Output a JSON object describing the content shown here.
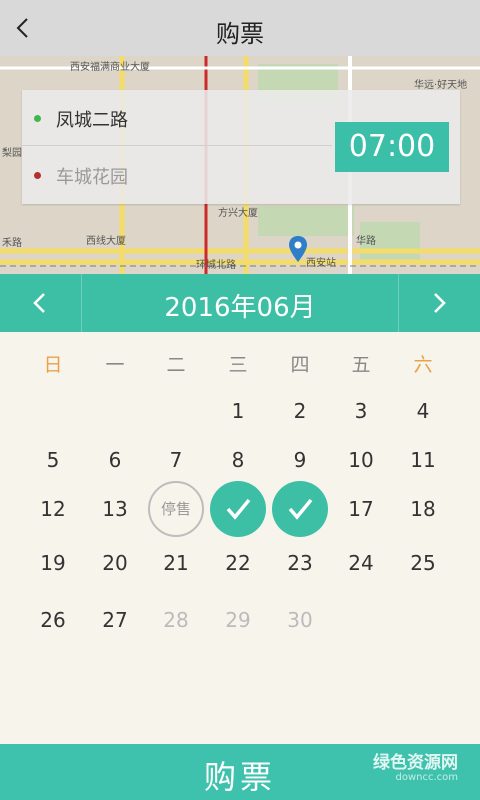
{
  "header": {
    "title": "购票",
    "back_icon": "chevron-left-icon"
  },
  "map": {
    "pois": [
      "西安福满商业大厦",
      "华远·好天地",
      "西线大厦",
      "方兴大厦",
      "西安站",
      "环城北路",
      "梨园",
      "禾路",
      "华路"
    ]
  },
  "route": {
    "from": "凤城二路",
    "to": "车城花园",
    "time": "07:00",
    "from_color": "#3fb64b",
    "to_color": "#b3302f"
  },
  "calendar": {
    "month_label": "2016年06月",
    "weekdays": [
      "日",
      "一",
      "二",
      "三",
      "四",
      "五",
      "六"
    ],
    "days": [
      [
        "",
        "",
        "",
        "1",
        "2",
        "3",
        "4"
      ],
      [
        "5",
        "6",
        "7",
        "8",
        "9",
        "10",
        "11"
      ],
      [
        "12",
        "13",
        "停售",
        "✓",
        "✓",
        "17",
        "18"
      ],
      [
        "19",
        "20",
        "21",
        "22",
        "23",
        "24",
        "25"
      ],
      [
        "26",
        "27",
        "28",
        "29",
        "30",
        "",
        ""
      ]
    ],
    "soldout_label": "停售",
    "accent": "#3dbfa6",
    "weekend_color": "#e8a24a"
  },
  "buy_button": {
    "label": "购票"
  },
  "watermark": {
    "text": "绿色资源网",
    "sub": "downcc.com"
  }
}
